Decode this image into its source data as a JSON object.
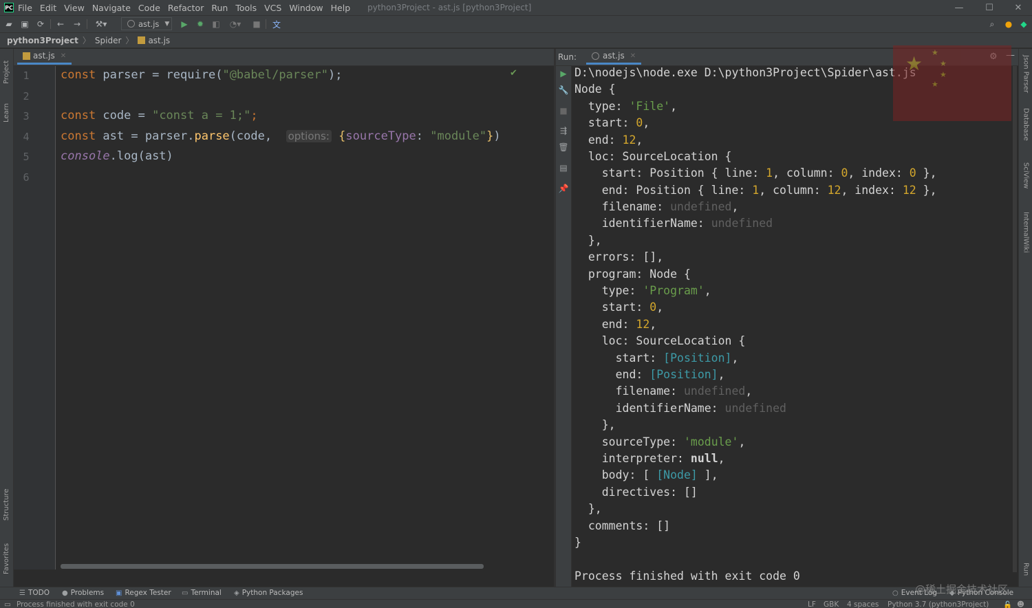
{
  "app": {
    "title": "python3Project - ast.js [python3Project]",
    "logo_text": "PC"
  },
  "menu": [
    "File",
    "Edit",
    "View",
    "Navigate",
    "Code",
    "Refactor",
    "Run",
    "Tools",
    "VCS",
    "Window",
    "Help"
  ],
  "toolbar": {
    "run_config_label": "ast.js"
  },
  "breadcrumb": {
    "project": "python3Project",
    "folder": "Spider",
    "file": "ast.js"
  },
  "left_strip": {
    "project": "Project",
    "learn": "Learn",
    "structure": "Structure",
    "favorites": "Favorites"
  },
  "right_strip": {
    "json_parser": "Json Parser",
    "database": "Database",
    "sciview": "SciView",
    "internalwiki": "InternalWiki",
    "run": "Run"
  },
  "editor": {
    "tab_label": "ast.js",
    "line_numbers": [
      "1",
      "2",
      "3",
      "4",
      "5",
      "6"
    ],
    "lines": {
      "l1": {
        "kw": "const",
        "rest_a": " parser = ",
        "fn": "require",
        "paren_open": "(",
        "str": "\"@babel/parser\"",
        "paren_close": ");"
      },
      "l3": {
        "kw": "const",
        "rest_a": " code = ",
        "str": "\"const a = 1;\"",
        "semi": ";"
      },
      "l4": {
        "kw": "const",
        "rest_a": " ast = parser.",
        "fn": "parse",
        "rest_b": "(code, ",
        "hint": "options:",
        "brace_open": "{",
        "prop": "sourceType",
        "colon": ": ",
        "str": "\"module\"",
        "brace_close": "}",
        "end": ")"
      },
      "l5": {
        "glob": "console",
        "rest_a": ".log(ast)"
      }
    }
  },
  "run_panel": {
    "title": "Run:",
    "tab_label": "ast.js",
    "console": {
      "l0": "D:\\nodejs\\node.exe D:\\python3Project\\Spider\\ast.js",
      "l1": "Node {",
      "l2a": "  type: ",
      "l2b": "'File'",
      "l2c": ",",
      "l3a": "  start: ",
      "l3b": "0",
      "l3c": ",",
      "l4a": "  end: ",
      "l4b": "12",
      "l4c": ",",
      "l5": "  loc: SourceLocation {",
      "l6a": "    start: Position { line: ",
      "l6b": "1",
      "l6c": ", column: ",
      "l6d": "0",
      "l6e": ", index: ",
      "l6f": "0",
      "l6g": " },",
      "l7a": "    end: Position { line: ",
      "l7b": "1",
      "l7c": ", column: ",
      "l7d": "12",
      "l7e": ", index: ",
      "l7f": "12",
      "l7g": " },",
      "l8a": "    filename: ",
      "l8b": "undefined",
      "l8c": ",",
      "l9a": "    identifierName: ",
      "l9b": "undefined",
      "l10": "  },",
      "l11": "  errors: [],",
      "l12": "  program: Node {",
      "l13a": "    type: ",
      "l13b": "'Program'",
      "l13c": ",",
      "l14a": "    start: ",
      "l14b": "0",
      "l14c": ",",
      "l15a": "    end: ",
      "l15b": "12",
      "l15c": ",",
      "l16": "    loc: SourceLocation {",
      "l17a": "      start: ",
      "l17b": "[Position]",
      "l17c": ",",
      "l18a": "      end: ",
      "l18b": "[Position]",
      "l18c": ",",
      "l19a": "      filename: ",
      "l19b": "undefined",
      "l19c": ",",
      "l20a": "      identifierName: ",
      "l20b": "undefined",
      "l21": "    },",
      "l22a": "    sourceType: ",
      "l22b": "'module'",
      "l22c": ",",
      "l23a": "    interpreter: ",
      "l23b": "null",
      "l23c": ",",
      "l24a": "    body: [ ",
      "l24b": "[Node]",
      "l24c": " ],",
      "l25": "    directives: []",
      "l26": "  },",
      "l27": "  comments: []",
      "l28": "}",
      "l30": "Process finished with exit code 0"
    }
  },
  "bottom_tabs": [
    "TODO",
    "Problems",
    "Regex Tester",
    "Terminal",
    "Python Packages"
  ],
  "bottom_right": {
    "event_log": "Event Log",
    "python_console": "Python Console",
    "watermark": "@稀土掘金技术社区"
  },
  "status": {
    "message": "Process finished with exit code 0",
    "line_sep": "LF",
    "encoding": "GBK",
    "indent": "4 spaces",
    "interpreter": "Python 3.7 (python3Project)"
  },
  "colors": {
    "editor_bg": "#2b2b2b",
    "chrome_bg": "#3c3f41",
    "keyword": "#cc7832",
    "string": "#6a8759",
    "function": "#ffc66d",
    "number": "#d4a72c"
  }
}
